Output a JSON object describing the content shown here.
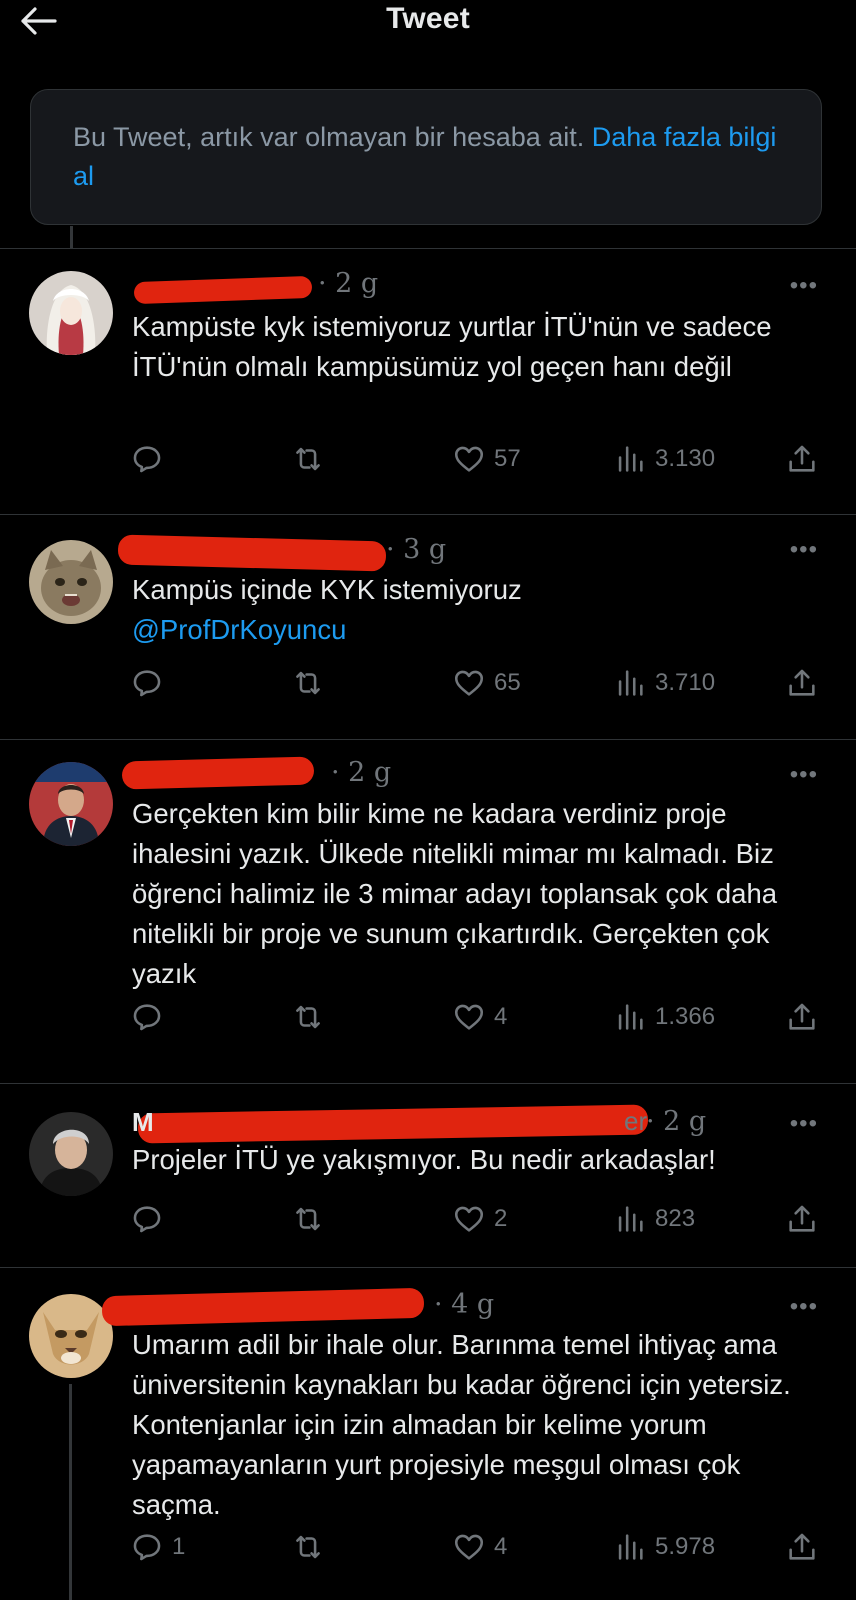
{
  "header": {
    "title": "Tweet",
    "back_icon": "arrow-left-icon"
  },
  "notice": {
    "text": "Bu Tweet, artık var olmayan bir hesaba ait.",
    "link": "Daha fazla bilgi al"
  },
  "colors": {
    "background": "#000000",
    "accent": "#1d9bf0",
    "muted": "#71767b",
    "redaction": "#e0240f"
  },
  "replies": [
    {
      "name_fragment": "",
      "handle_fragment": "",
      "time": "· 2 g",
      "text": "Kampüste kyk istemiyoruz yurtlar İTÜ'nün ve sadece İTÜ'nün olmalı kampüsümüz yol geçen hanı değil",
      "mention": "",
      "stats": {
        "replies": "",
        "likes": "57",
        "views": "3.130"
      }
    },
    {
      "name_fragment": "",
      "handle_fragment": "",
      "time": "· 3 g",
      "text": "Kampüs içinde KYK istemiyoruz",
      "mention": "@ProfDrKoyuncu",
      "stats": {
        "replies": "",
        "likes": "65",
        "views": "3.710"
      }
    },
    {
      "name_fragment": "",
      "handle_fragment": "",
      "time": "· 2 g",
      "text": "Gerçekten kim bilir kime ne kadara verdiniz proje ihalesini yazık. Ülkede nitelikli mimar mı kalmadı. Biz öğrenci halimiz ile 3 mimar adayı toplansak çok daha nitelikli bir proje ve sunum çıkartırdık. Gerçekten çok yazık",
      "mention": "",
      "stats": {
        "replies": "",
        "likes": "4",
        "views": "1.366"
      }
    },
    {
      "name_fragment": "M",
      "handle_fragment": "er",
      "time": "· 2 g",
      "text": "Projeler İTÜ ye yakışmıyor. Bu nedir arkadaşlar!",
      "mention": "",
      "stats": {
        "replies": "",
        "likes": "2",
        "views": "823"
      }
    },
    {
      "name_fragment": "",
      "handle_fragment": "",
      "time": "· 4 g",
      "text": "Umarım adil bir ihale olur. Barınma temel ihtiyaç ama üniversitenin kaynakları bu kadar öğrenci için yetersiz. Kontenjanlar için izin almadan bir kelime yorum yapamayanların yurt projesiyle meşgul olması çok saçma.",
      "mention": "",
      "stats": {
        "replies": "1",
        "likes": "4",
        "views": "5.978"
      }
    }
  ]
}
